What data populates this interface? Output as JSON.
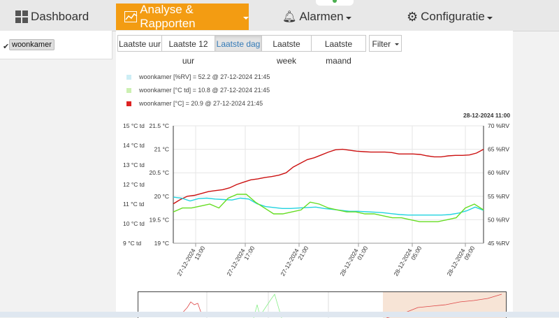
{
  "nav": {
    "dashboard": "Dashboard",
    "analyse": "Analyse & Rapporten",
    "alarmen": "Alarmen",
    "configuratie": "Configuratie"
  },
  "sidebar": {
    "checkbox": "✔",
    "sensor": "woonkamer"
  },
  "ranges": [
    "Laatste uur",
    "Laatste 12 uur",
    "Laatste dag",
    "Laatste week",
    "Laatste maand"
  ],
  "filter": "Filter",
  "legend": [
    {
      "label": "woonkamer [%RV] = 52.2 @ 27-12-2024 21:45",
      "color": "#cdeef5"
    },
    {
      "label": "woonkamer [°C td] = 10.8 @ 27-12-2024 21:45",
      "color": "#ccf0b2"
    },
    {
      "label": "woonkamer [°C] = 20.9 @ 27-12-2024 21:45",
      "color": "#dd2222"
    }
  ],
  "hover_label": "28-12-2024 11:00",
  "chart_data": {
    "type": "line",
    "x_ticks": [
      "27-12-2024 13:00",
      "27-12-2024 17:00",
      "27-12-2024 21:00",
      "28-12-2024 01:00",
      "28-12-2024 05:00",
      "28-12-2024 09:00"
    ],
    "y_td_ticks": [
      "15 °C td",
      "14 °C td",
      "13 °C td",
      "12 °C td",
      "11 °C td",
      "10 °C td",
      "9 °C td"
    ],
    "y_c_ticks": [
      "21.5 °C",
      "21 °C",
      "20.5 °C",
      "20 °C",
      "19.5 °C",
      "19 °C"
    ],
    "y_rv_ticks": [
      "70 %RV",
      "65 %RV",
      "60 %RV",
      "55 %RV",
      "50 %RV",
      "45 %RV"
    ],
    "ylim_c": [
      19,
      21.5
    ],
    "series": [
      {
        "name": "woonkamer [°C]",
        "color": "#cc1111",
        "values": [
          19.84,
          19.93,
          20.0,
          20.02,
          20.06,
          20.1,
          20.12,
          20.14,
          20.18,
          20.25,
          20.3,
          20.35,
          20.37,
          20.4,
          20.42,
          20.45,
          20.5,
          20.62,
          20.7,
          20.78,
          20.82,
          20.88,
          20.94,
          20.99,
          21.0,
          20.98,
          20.96,
          20.95,
          20.94,
          20.94,
          20.94,
          20.93,
          20.9,
          20.9,
          20.9,
          20.89,
          20.86,
          20.84,
          20.84,
          20.86,
          20.87,
          20.87,
          20.88,
          20.92,
          21.0
        ]
      },
      {
        "name": "woonkamer [%RV]",
        "color": "#22d3e0",
        "values": [
          54.8,
          54.6,
          54.0,
          54.5,
          54.6,
          54.4,
          54.3,
          54.2,
          54.6,
          54.4,
          53.4,
          52.8,
          52.6,
          52.4,
          52.4,
          52.5,
          52.6,
          52.7,
          52.4,
          52.2,
          52.0,
          51.8,
          51.8,
          51.7,
          51.6,
          51.5,
          51.3,
          51.1,
          51.0,
          51.0,
          51.0,
          51.0,
          51.0,
          51.1,
          51.4,
          51.9,
          52.7,
          52.0
        ]
      },
      {
        "name": "woonkamer [°C td]",
        "color": "#66dd22",
        "values": [
          10.6,
          10.8,
          10.8,
          10.9,
          11.0,
          10.8,
          11.3,
          11.5,
          11.5,
          11.1,
          10.8,
          10.5,
          10.5,
          10.6,
          10.7,
          11.1,
          11.0,
          10.8,
          10.7,
          10.6,
          10.6,
          10.5,
          10.5,
          10.4,
          10.3,
          10.3,
          10.2,
          10.1,
          10.1,
          10.1,
          10.2,
          10.3,
          10.8,
          11.0,
          10.7
        ]
      }
    ]
  }
}
